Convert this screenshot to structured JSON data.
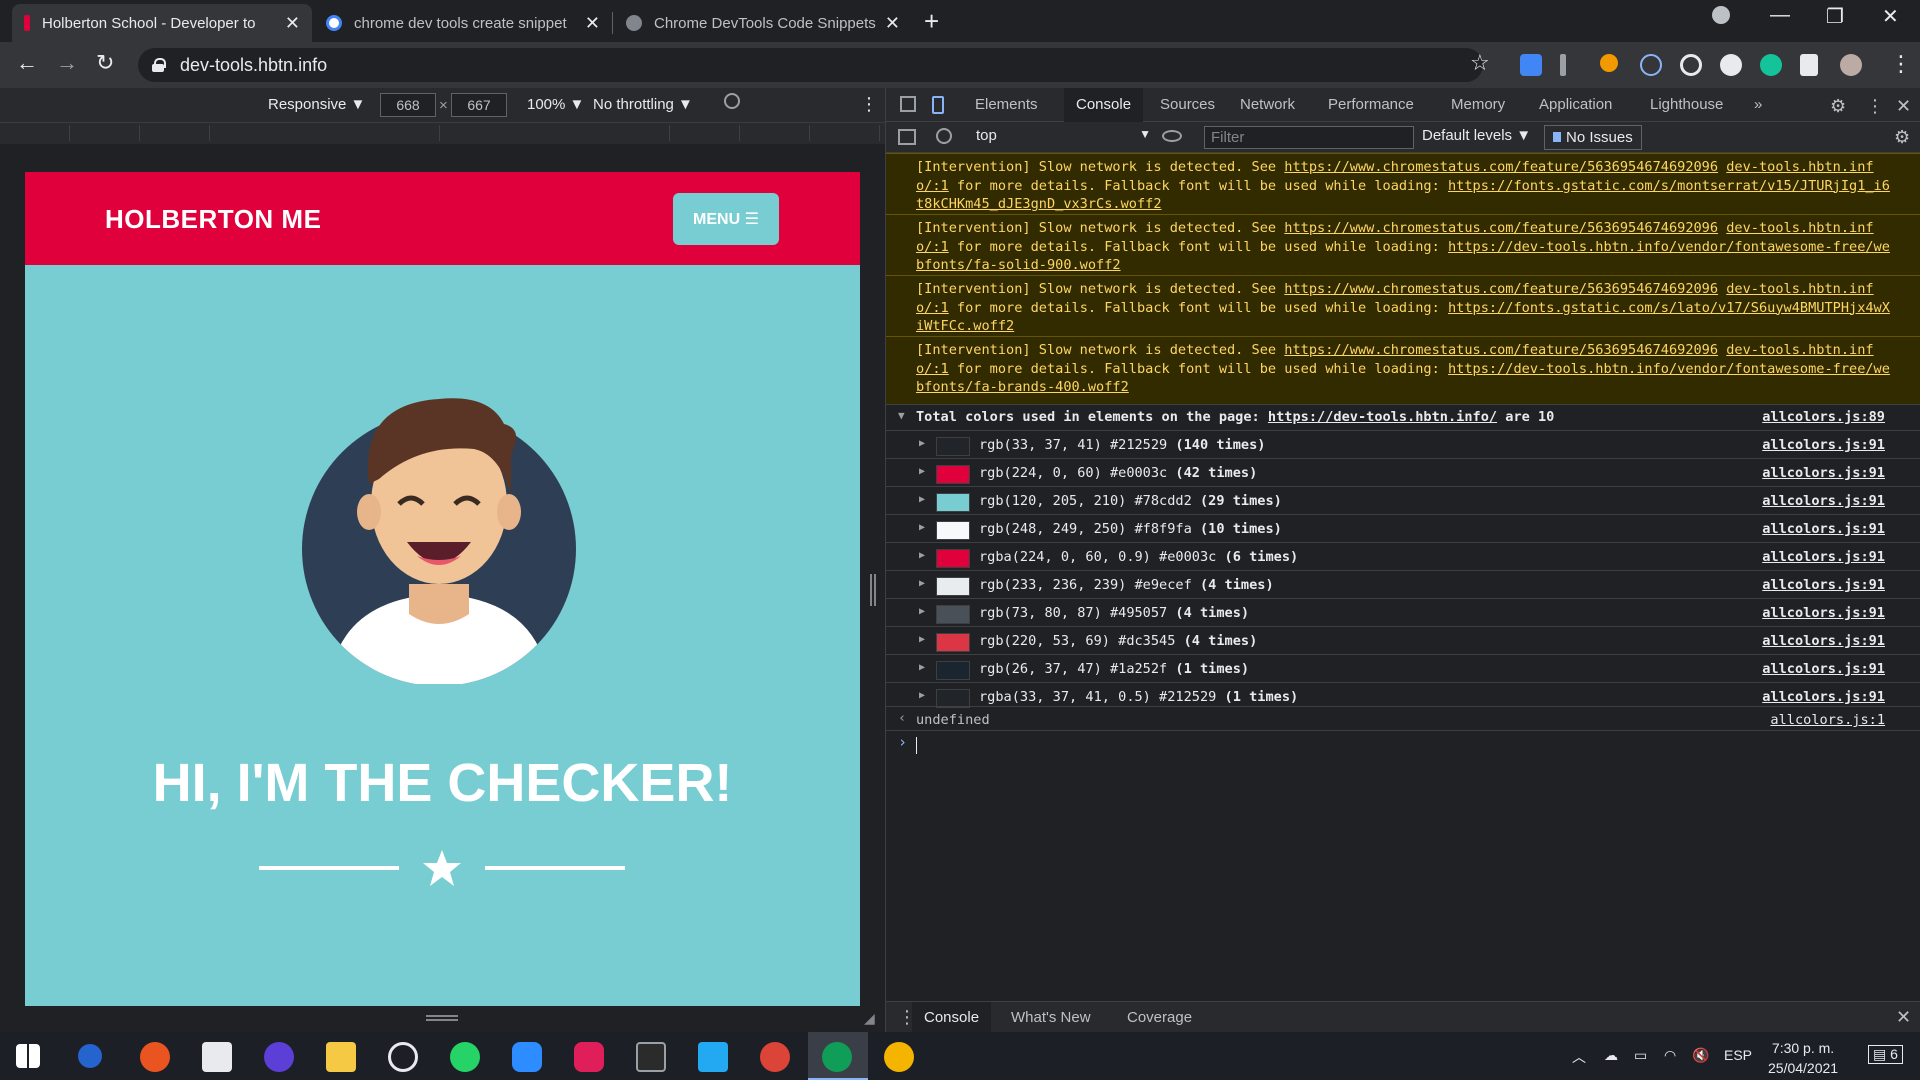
{
  "browser": {
    "tabs": [
      {
        "title": "Holberton School - Developer to",
        "fav_color": "#e0003c",
        "active": true
      },
      {
        "title": "chrome dev tools create snippet",
        "fav_color": "#ffffff",
        "active": false
      },
      {
        "title": "Chrome DevTools Code Snippets",
        "fav_color": "#80868b",
        "active": false
      }
    ],
    "new_tab_label": "+",
    "window_controls": {
      "minimize": "—",
      "maximize": "❐",
      "close": "✕"
    },
    "url": "dev-tools.hbtn.info",
    "nav": {
      "back": "←",
      "forward": "→",
      "reload": "↻"
    },
    "bookmark_star": "☆"
  },
  "device_toolbar": {
    "device": "Responsive ▼",
    "width": "668",
    "times": "×",
    "height": "667",
    "zoom": "100% ▼",
    "throttling": "No throttling ▼",
    "more": "⋮"
  },
  "page_preview": {
    "brand": "HOLBERTON ME",
    "menu_button": "MENU ☰",
    "headline": "HI, I'M THE CHECKER!",
    "colors": {
      "nav": "#e0003c",
      "background": "#78cdd2",
      "avatar_circle": "#2e3f55"
    }
  },
  "devtools": {
    "tabs": [
      "Elements",
      "Console",
      "Sources",
      "Network",
      "Performance",
      "Memory",
      "Application",
      "Lighthouse",
      "»"
    ],
    "active_tab": "Console",
    "context": "top",
    "filter_placeholder": "Filter",
    "levels": "Default levels ▼",
    "issues": "No Issues",
    "warnings": [
      {
        "pre": "[Intervention] Slow network is detected. See ",
        "link1": "https://www.chromestatus.com/feature/5636954674692096",
        "mid": " for more details. Fallback font will be used while loading: ",
        "link2": "https://fonts.gstatic.com/s/montserrat/v15/JTURjIg1_i6t8kCHKm45_dJE3gnD_vx3rCs.woff2",
        "source": "dev-tools.hbtn.info/:1"
      },
      {
        "pre": "[Intervention] Slow network is detected. See ",
        "link1": "https://www.chromestatus.com/feature/5636954674692096",
        "mid": " for more details. Fallback font will be used while loading: ",
        "link2": "https://dev-tools.hbtn.info/vendor/fontawesome-free/webfonts/fa-solid-900.woff2",
        "source": "dev-tools.hbtn.info/:1"
      },
      {
        "pre": "[Intervention] Slow network is detected. See ",
        "link1": "https://www.chromestatus.com/feature/5636954674692096",
        "mid": " for more details. Fallback font will be used while loading: ",
        "link2": "https://fonts.gstatic.com/s/lato/v17/S6uyw4BMUTPHjx4wXiWtFCc.woff2",
        "source": "dev-tools.hbtn.info/:1"
      },
      {
        "pre": "[Intervention] Slow network is detected. See ",
        "link1": "https://www.chromestatus.com/feature/5636954674692096",
        "mid": " for more details. Fallback font will be used while loading: ",
        "link2": "https://dev-tools.hbtn.info/vendor/fontawesome-free/webfonts/fa-brands-400.woff2",
        "source": "dev-tools.hbtn.info/:1"
      }
    ],
    "group": {
      "prefix": "Total colors used in elements on the page: ",
      "url": "https://dev-tools.hbtn.info/",
      "suffix": " are 10",
      "source": "allcolors.js:89"
    },
    "color_rows": [
      {
        "label": "rgb(33, 37, 41) #212529 ",
        "count": "(140 times)",
        "swatch": "#212529",
        "source": "allcolors.js:91"
      },
      {
        "label": "rgb(224, 0, 60) #e0003c ",
        "count": "(42 times)",
        "swatch": "#e0003c",
        "source": "allcolors.js:91"
      },
      {
        "label": "rgb(120, 205, 210) #78cdd2 ",
        "count": "(29 times)",
        "swatch": "#78cdd2",
        "source": "allcolors.js:91"
      },
      {
        "label": "rgb(248, 249, 250) #f8f9fa ",
        "count": "(10 times)",
        "swatch": "#f8f9fa",
        "source": "allcolors.js:91"
      },
      {
        "label": "rgba(224, 0, 60, 0.9) #e0003c ",
        "count": "(6 times)",
        "swatch": "#e0003c",
        "source": "allcolors.js:91"
      },
      {
        "label": "rgb(233, 236, 239) #e9ecef ",
        "count": "(4 times)",
        "swatch": "#e9ecef",
        "source": "allcolors.js:91"
      },
      {
        "label": "rgb(73, 80, 87) #495057 ",
        "count": "(4 times)",
        "swatch": "#495057",
        "source": "allcolors.js:91"
      },
      {
        "label": "rgb(220, 53, 69) #dc3545 ",
        "count": "(4 times)",
        "swatch": "#dc3545",
        "source": "allcolors.js:91"
      },
      {
        "label": "rgb(26, 37, 47) #1a252f ",
        "count": "(1 times)",
        "swatch": "#1a252f",
        "source": "allcolors.js:91"
      },
      {
        "label": "rgba(33, 37, 41, 0.5) #212529 ",
        "count": "(1 times)",
        "swatch": "#212529",
        "source": "allcolors.js:91"
      }
    ],
    "result": {
      "value": "undefined",
      "source": "allcolors.js:1"
    },
    "drawer_tabs": [
      "Console",
      "What's New",
      "Coverage"
    ]
  },
  "taskbar": {
    "language": "ESP",
    "time": "7:30 p. m.",
    "date": "25/04/2021",
    "notifications": "6"
  }
}
